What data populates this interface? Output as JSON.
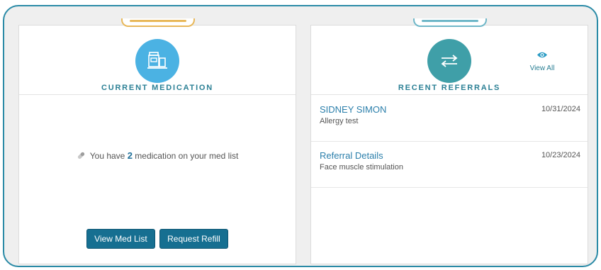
{
  "medication": {
    "title": "CURRENT MEDICATION",
    "message_prefix": "You have",
    "count": "2",
    "message_suffix": "medication on your med list",
    "view_button": "View Med List",
    "refill_button": "Request Refill",
    "accent_color": "#e8b85a",
    "icon": "pharmacy-icon"
  },
  "referrals": {
    "title": "RECENT REFERRALS",
    "view_all": "View All",
    "accent_color": "#6fb7c8",
    "icon": "transfer-arrows-icon",
    "items": [
      {
        "name": "SIDNEY SIMON",
        "description": "Allergy test",
        "date": "10/31/2024"
      },
      {
        "name": "Referral Details",
        "description": "Face muscle stimulation",
        "date": "10/23/2024"
      }
    ]
  }
}
